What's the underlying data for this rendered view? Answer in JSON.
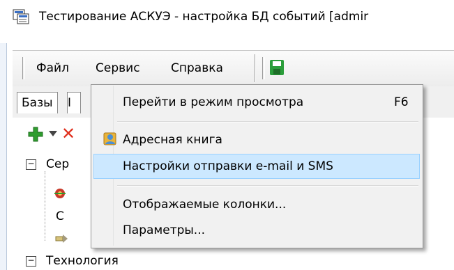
{
  "window": {
    "title": "Тестирование АСКУЭ - настройка БД событий [admir"
  },
  "menubar": {
    "items": [
      "Файл",
      "Сервис",
      "Справка"
    ]
  },
  "tabs": [
    {
      "label": "Базы"
    },
    {
      "label": "I"
    }
  ],
  "tree": {
    "node1_label": "Сер",
    "child_label": "С",
    "node2_label": "Технология"
  },
  "context_menu": {
    "items": [
      {
        "label": "Перейти в режим просмотра",
        "shortcut": "F6",
        "highlighted": false
      },
      {
        "label": "Адресная книга",
        "icon": "address-book-icon",
        "highlighted": false
      },
      {
        "label": "Настройки отправки e-mail и SMS",
        "highlighted": true
      },
      {
        "label": "Отображаемые колонки...",
        "highlighted": false
      },
      {
        "label": "Параметры...",
        "highlighted": false
      }
    ]
  },
  "colors": {
    "highlight_bg": "#cce8ff",
    "highlight_border": "#99d1ff",
    "menu_bg": "#f1f1f1",
    "save_icon": "#2a9d3a",
    "add_icon": "#2e9d2e",
    "delete_icon": "#e0301e"
  }
}
